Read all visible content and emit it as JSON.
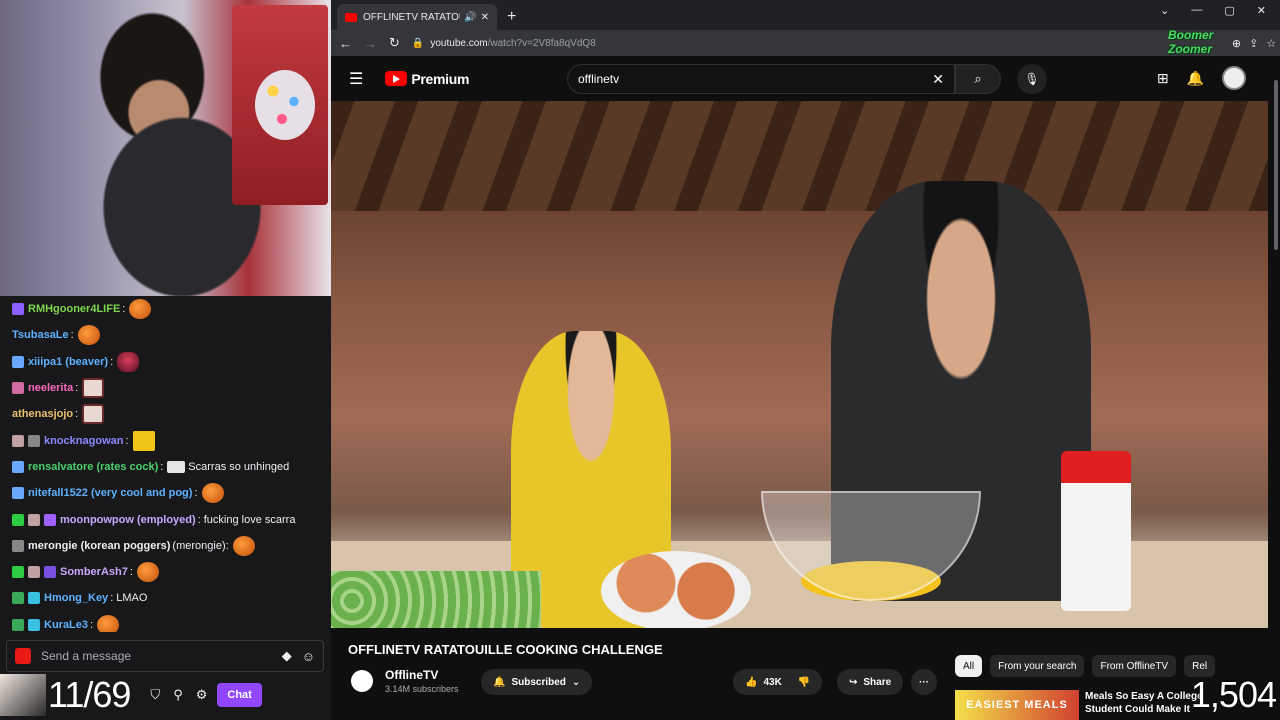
{
  "chat": {
    "messages": [
      {
        "user": "RMHgooner4LIFE",
        "color": "#7cd64a",
        "sep": ":",
        "text": "",
        "emote": "orange",
        "badges": [
          "#8a60ff"
        ]
      },
      {
        "user": "TsubasaLe",
        "color": "#5fb2ff",
        "sep": ":",
        "text": "",
        "emote": "orange",
        "badges": []
      },
      {
        "user": "xiiipa1 (beaver)",
        "color": "#5fb2ff",
        "sep": ":",
        "text": "",
        "emote": "bird",
        "badges": [
          "#6aa8ff"
        ]
      },
      {
        "user": "neelerita",
        "color": "#ff6ac1",
        "sep": ":",
        "text": "",
        "emote": "sq",
        "badges": [
          "#d06aa0"
        ]
      },
      {
        "user": "athenasjojo",
        "color": "#e8c070",
        "sep": ":",
        "text": "",
        "emote": "sq",
        "badges": []
      },
      {
        "user": "knocknagowan",
        "color": "#8a8aff",
        "sep": ":",
        "text": "",
        "emote": "yellow",
        "badges": [
          "#c0a0a0",
          "#888888"
        ]
      },
      {
        "user": "rensalvatore (rates cock)",
        "color": "#4ad06a",
        "sep": ":",
        "text": "Scarras so unhinged",
        "emote": "glass",
        "badges": [
          "#6aa8ff"
        ]
      },
      {
        "user": "nitefall1522 (very cool and pog)",
        "color": "#5fb2ff",
        "sep": ":",
        "text": "",
        "emote": "orange",
        "badges": [
          "#6aa8ff"
        ]
      },
      {
        "user": "moonpowpow (employed)",
        "color": "#c8a8ff",
        "sep": ":",
        "text": "fucking love scarra",
        "emote": "",
        "badges": [
          "#2ecc40",
          "#c0a0a0",
          "#a060ff"
        ]
      },
      {
        "user": "merongie (korean poggers)",
        "color": "#efeff1",
        "sep": " (merongie):",
        "text": "",
        "emote": "orange",
        "badges": [
          "#888888"
        ]
      },
      {
        "user": "SomberAsh7",
        "color": "#c8a8ff",
        "sep": ":",
        "text": "",
        "emote": "orange",
        "badges": [
          "#2ecc40",
          "#c0a0a0",
          "#7a50e0"
        ]
      },
      {
        "user": "Hmong_Key",
        "color": "#5fb2ff",
        "sep": ":",
        "text": "LMAO",
        "emote": "",
        "badges": [
          "#3aaa5a",
          "#3ac0e0"
        ]
      },
      {
        "user": "KuraLe3",
        "color": "#5fb2ff",
        "sep": ":",
        "text": "",
        "emote": "orange",
        "badges": [
          "#3aaa5a",
          "#3ac0e0"
        ]
      }
    ],
    "input_placeholder": "Send a message",
    "points": "11/69",
    "chat_button": "Chat"
  },
  "browser": {
    "tab_title": "OFFLINETV RATATOUILLE C",
    "url_host": "youtube.com",
    "url_path": "/watch?v=2V8fa8qVdQ8"
  },
  "youtube": {
    "logo_text": "Premium",
    "search_query": "offlinetv",
    "video_title": "OFFLINETV RATATOUILLE COOKING CHALLENGE",
    "channel": "OfflineTV",
    "subscribers": "3.14M subscribers",
    "subscribed_label": "Subscribed",
    "likes": "43K",
    "share_label": "Share",
    "chips": [
      "All",
      "From your search",
      "From OfflineTV",
      "Rel"
    ],
    "rec_thumb_text": "EASIEST MEALS",
    "rec_title": "Meals So Easy A College Student Could Make It"
  },
  "stream": {
    "viewers": "1,504",
    "watermark": "Boomer Zoomer"
  },
  "colors": {
    "twitch_purple": "#9147ff",
    "youtube_red": "#ff0000"
  }
}
